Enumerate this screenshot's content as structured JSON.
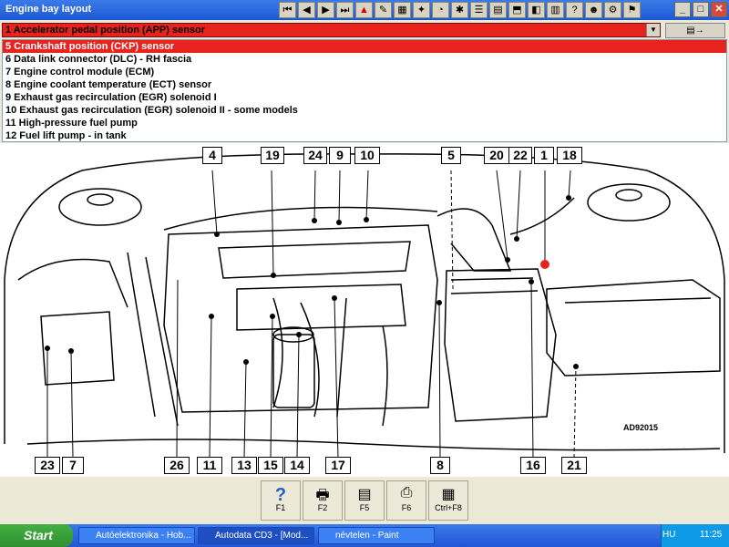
{
  "window": {
    "title": "Engine bay layout"
  },
  "toolbar": {
    "icons": [
      "first-icon",
      "prev-icon",
      "next-icon",
      "last-icon",
      "warning-icon",
      "tool-icon",
      "image-icon",
      "wrench-icon",
      "gauge-icon",
      "settings-icon",
      "list-icon",
      "document-icon",
      "car-icon",
      "engine-icon",
      "chart-icon",
      "help-icon",
      "user-icon",
      "tool2-icon",
      "flag-icon"
    ]
  },
  "window_controls": {
    "minimize": "_",
    "maximize": "□",
    "close": "✕"
  },
  "dropdown": {
    "selected": "1   Accelerator pedal position (APP) sensor",
    "arrow": "▼"
  },
  "side_button": {
    "label": "▤→"
  },
  "list": {
    "items": [
      {
        "label": "5   Crankshaft position (CKP) sensor",
        "selected": true
      },
      {
        "label": "6   Data link connector (DLC) - RH fascia",
        "selected": false
      },
      {
        "label": "7   Engine control module (ECM)",
        "selected": false
      },
      {
        "label": "8   Engine coolant temperature (ECT) sensor",
        "selected": false
      },
      {
        "label": "9   Exhaust gas recirculation (EGR) solenoid I",
        "selected": false
      },
      {
        "label": "10  Exhaust gas recirculation (EGR) solenoid II - some models",
        "selected": false
      },
      {
        "label": "11  High-pressure fuel pump",
        "selected": false
      },
      {
        "label": "12  Fuel lift pump - in tank",
        "selected": false
      }
    ]
  },
  "diagram": {
    "code": "AD92015",
    "labels": {
      "l4": "4",
      "l19": "19",
      "l24": "24",
      "l9": "9",
      "l10": "10",
      "l5": "5",
      "l20": "20",
      "l22": "22",
      "l1": "1",
      "l18": "18",
      "l23": "23",
      "l7": "7",
      "l26": "26",
      "l11": "11",
      "l13": "13",
      "l15": "15",
      "l14": "14",
      "l17": "17",
      "l8": "8",
      "l16": "16",
      "l21": "21"
    }
  },
  "function_keys": [
    {
      "label": "F1",
      "icon": "help-icon"
    },
    {
      "label": "F2",
      "icon": "print-icon"
    },
    {
      "label": "F5",
      "icon": "document-icon"
    },
    {
      "label": "F6",
      "icon": "printer-icon"
    },
    {
      "label": "Ctrl+F8",
      "icon": "table-icon"
    }
  ],
  "taskbar": {
    "start": "Start",
    "tasks": [
      {
        "label": "Autóelektronika - Hob..."
      },
      {
        "label": "Autodata CD3 - [Mod..."
      },
      {
        "label": "névtelen - Paint"
      }
    ],
    "language": "HU",
    "clock": "11:25"
  },
  "colors": {
    "highlight": "#e8231e",
    "titlebar": "#1c58d4",
    "taskbar": "#2256d6"
  }
}
